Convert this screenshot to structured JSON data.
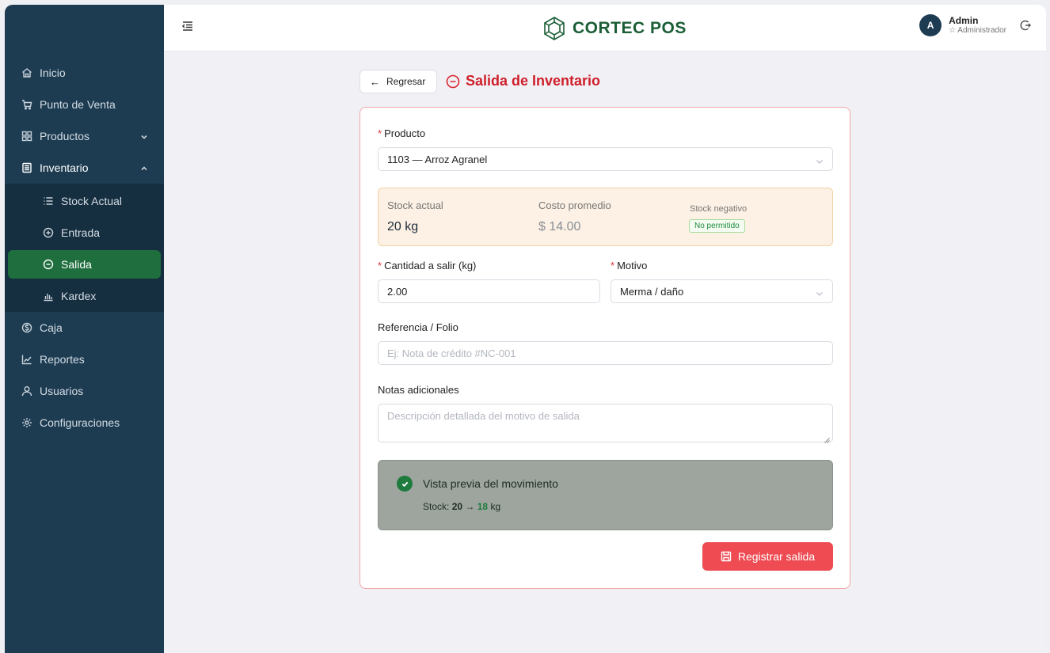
{
  "app": {
    "brand": "CORTEC POS"
  },
  "user": {
    "initial": "A",
    "name": "Admin",
    "role": "☆ Administrador"
  },
  "sidebar": {
    "items": [
      {
        "label": "Inicio",
        "icon": "home-icon"
      },
      {
        "label": "Punto de Venta",
        "icon": "cart-icon"
      },
      {
        "label": "Productos",
        "icon": "grid-icon",
        "expandable": true
      },
      {
        "label": "Inventario",
        "icon": "inventory-icon",
        "expanded": true
      },
      {
        "label": "Caja",
        "icon": "dollar-icon"
      },
      {
        "label": "Reportes",
        "icon": "chart-line-icon"
      },
      {
        "label": "Usuarios",
        "icon": "user-icon"
      },
      {
        "label": "Configuraciones",
        "icon": "gear-icon"
      }
    ],
    "submenu": [
      {
        "label": "Stock Actual",
        "icon": "list-icon"
      },
      {
        "label": "Entrada",
        "icon": "plus-circle-icon"
      },
      {
        "label": "Salida",
        "icon": "minus-circle-icon",
        "active": true
      },
      {
        "label": "Kardex",
        "icon": "bar-chart-icon"
      }
    ]
  },
  "page": {
    "back_label": "Regresar",
    "title": "Salida de Inventario"
  },
  "form": {
    "product_label": "Producto",
    "product_value": "1103 — Arroz Agranel",
    "stock_actual_label": "Stock actual",
    "stock_actual_value": "20 kg",
    "costo_label": "Costo promedio",
    "costo_value": "$ 14.00",
    "stock_negativo_label": "Stock negativo",
    "stock_negativo_badge": "No permitido",
    "cantidad_label": "Cantidad a salir (kg)",
    "cantidad_value": "2.00",
    "motivo_label": "Motivo",
    "motivo_value": "Merma / daño",
    "referencia_label": "Referencia / Folio",
    "referencia_placeholder": "Ej: Nota de crédito #NC-001",
    "notas_label": "Notas adicionales",
    "notas_placeholder": "Descripción detallada del motivo de salida",
    "preview_title": "Vista previa del movimiento",
    "preview_prefix": "Stock:",
    "preview_from": "20",
    "preview_arrow": "→",
    "preview_to": "18",
    "preview_unit": "kg",
    "submit_label": "Registrar salida"
  },
  "colors": {
    "sidebar_bg": "#1d3c52",
    "active_green": "#1f6e3e",
    "accent_red": "#cf1f2a",
    "submit_red": "#ee4b52"
  }
}
